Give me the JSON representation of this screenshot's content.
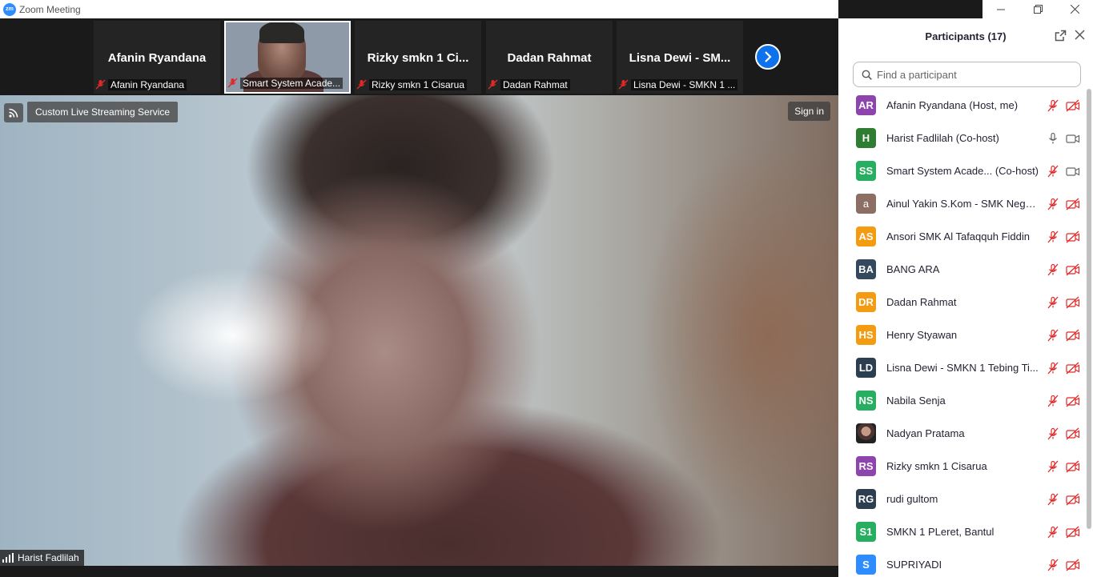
{
  "window": {
    "title": "Zoom Meeting",
    "app_logo": "zm"
  },
  "strip": {
    "thumbnails": [
      {
        "big_name": "Afanin Ryandana",
        "label": "Afanin Ryandana"
      },
      {
        "big_name": "",
        "label": "Smart System Acade..."
      },
      {
        "big_name": "Rizky smkn 1 Ci...",
        "label": "Rizky smkn 1 Cisarua"
      },
      {
        "big_name": "Dadan Rahmat",
        "label": "Dadan Rahmat"
      },
      {
        "big_name": "Lisna Dewi - SM...",
        "label": "Lisna Dewi - SMKN 1 ..."
      }
    ]
  },
  "main": {
    "live_label": "Custom Live Streaming Service",
    "signin_label": "Sign in",
    "active_speaker": "Harist Fadlilah"
  },
  "panel": {
    "title": "Participants (17)",
    "search_placeholder": "Find a participant",
    "participants": [
      {
        "initials": "AR",
        "name": "Afanin Ryandana (Host, me)",
        "color": "#8e44ad",
        "mic": "muted",
        "video": "off"
      },
      {
        "initials": "H",
        "name": "Harist Fadlilah (Co-host)",
        "color": "#2e7d32",
        "mic": "on",
        "video": "on"
      },
      {
        "initials": "SS",
        "name": "Smart System Acade...  (Co-host)",
        "color": "#27ae60",
        "mic": "muted",
        "video": "on"
      },
      {
        "initials": "a",
        "name": "Ainul Yakin S.Kom - SMK Nege...",
        "color": "#8d6e63",
        "mic": "muted",
        "video": "off"
      },
      {
        "initials": "AS",
        "name": "Ansori SMK Al Tafaqquh Fiddin",
        "color": "#f39c12",
        "mic": "muted",
        "video": "off"
      },
      {
        "initials": "BA",
        "name": "BANG ARA",
        "color": "#34495e",
        "mic": "muted",
        "video": "off"
      },
      {
        "initials": "DR",
        "name": "Dadan Rahmat",
        "color": "#f39c12",
        "mic": "muted",
        "video": "off"
      },
      {
        "initials": "HS",
        "name": "Henry Styawan",
        "color": "#f39c12",
        "mic": "muted",
        "video": "off"
      },
      {
        "initials": "LD",
        "name": "Lisna Dewi - SMKN 1 Tebing Ti...",
        "color": "#2c3e50",
        "mic": "muted",
        "video": "off"
      },
      {
        "initials": "NS",
        "name": "Nabila Senja",
        "color": "#27ae60",
        "mic": "muted",
        "video": "off"
      },
      {
        "initials": "",
        "name": "Nadyan Pratama",
        "color": "#6d4c41",
        "mic": "muted",
        "video": "off"
      },
      {
        "initials": "RS",
        "name": "Rizky smkn 1 Cisarua",
        "color": "#8e44ad",
        "mic": "muted",
        "video": "off"
      },
      {
        "initials": "RG",
        "name": "rudi gultom",
        "color": "#2c3e50",
        "mic": "muted",
        "video": "off"
      },
      {
        "initials": "S1",
        "name": "SMKN 1 PLeret, Bantul",
        "color": "#27ae60",
        "mic": "muted",
        "video": "off"
      },
      {
        "initials": "S",
        "name": "SUPRIYADI",
        "color": "#2d8cff",
        "mic": "muted",
        "video": "off"
      }
    ]
  }
}
